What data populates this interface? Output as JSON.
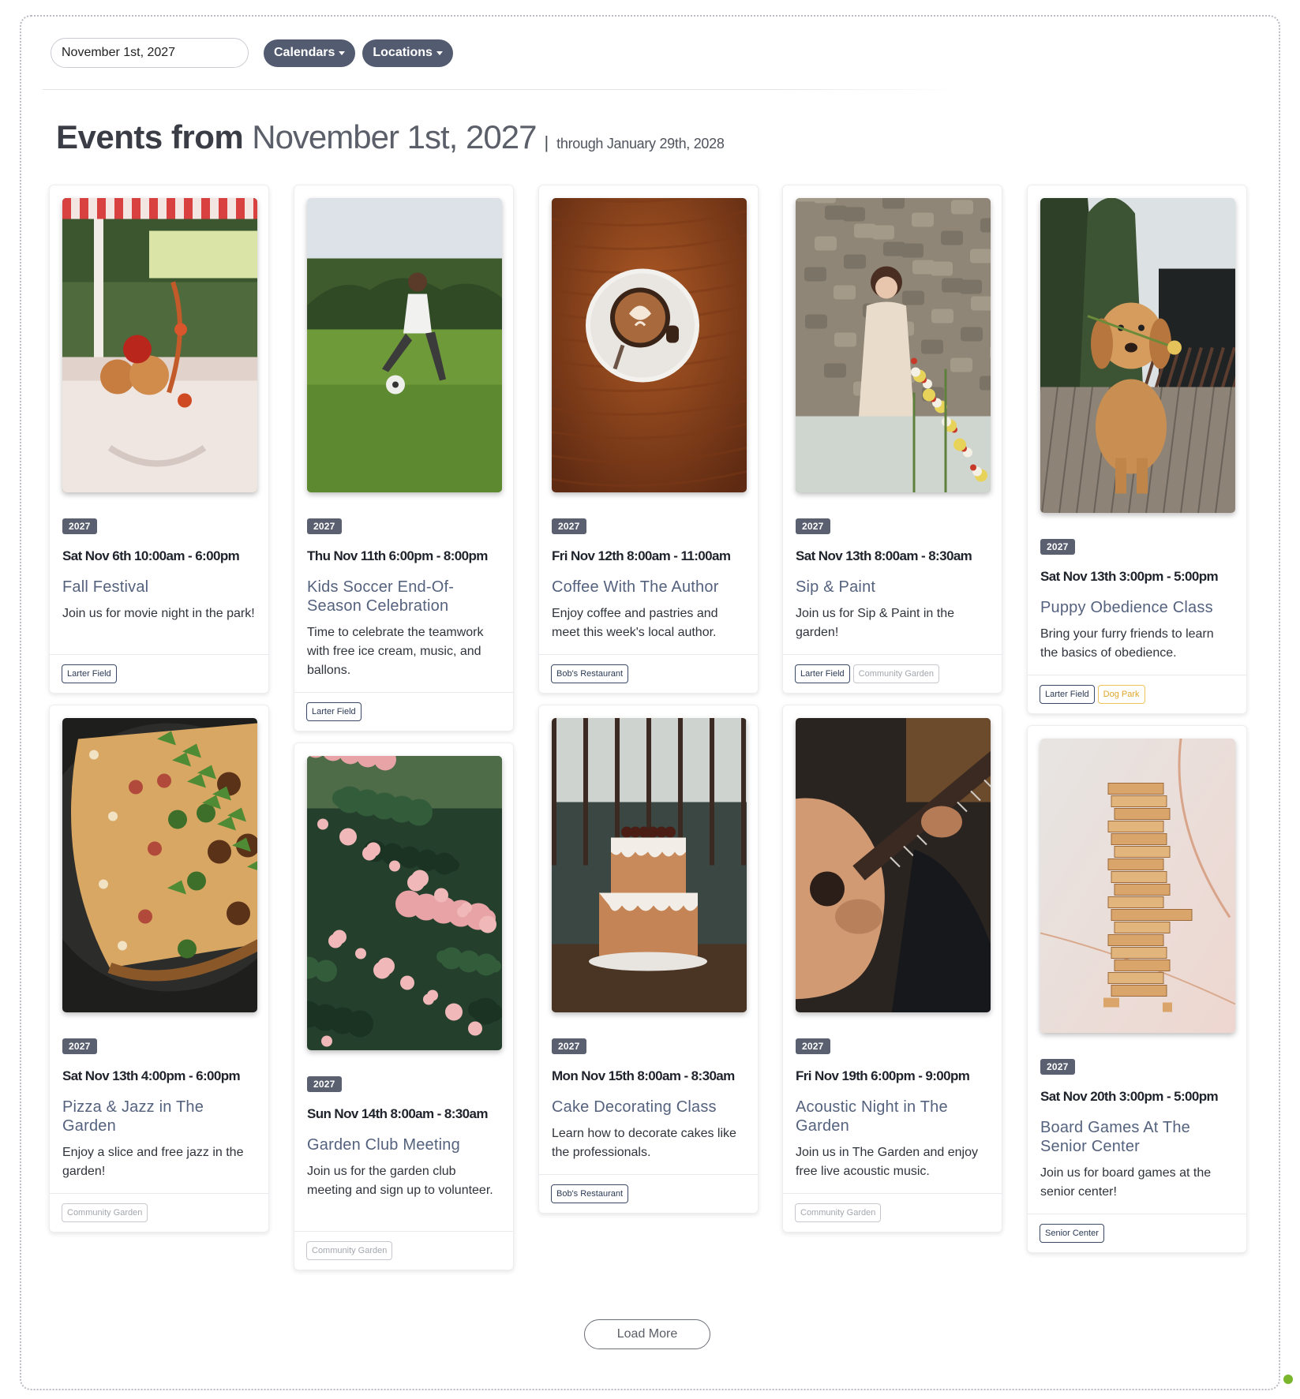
{
  "toolbar": {
    "date_value": "November 1st, 2027",
    "calendars_label": "Calendars",
    "locations_label": "Locations"
  },
  "heading": {
    "prefix": "Events from",
    "start_date": "November 1st, 2027",
    "separator": "|",
    "through": "through January 29th, 2028"
  },
  "events": [
    {
      "year": "2027",
      "when": "Sat Nov 6th 10:00am - 6:00pm",
      "title": "Fall Festival",
      "desc": "Join us for movie night in the park!",
      "tags": [
        {
          "label": "Larter Field",
          "style": "dark"
        }
      ],
      "image": "autumn-cart"
    },
    {
      "year": "2027",
      "when": "Thu Nov 11th 6:00pm - 8:00pm",
      "title": "Kids Soccer End-Of-Season Celebration",
      "desc": "Time to celebrate the teamwork with free ice cream, music, and ballons.",
      "tags": [
        {
          "label": "Larter Field",
          "style": "dark"
        }
      ],
      "image": "soccer-kid"
    },
    {
      "year": "2027",
      "when": "Fri Nov 12th 8:00am - 11:00am",
      "title": "Coffee With The Author",
      "desc": "Enjoy coffee and pastries and meet this week's local author.",
      "tags": [
        {
          "label": "Bob's Restaurant",
          "style": "dark"
        }
      ],
      "image": "latte"
    },
    {
      "year": "2027",
      "when": "Sat Nov 13th 8:00am - 8:30am",
      "title": "Sip & Paint",
      "desc": "Join us for Sip & Paint in the garden!",
      "tags": [
        {
          "label": "Larter Field",
          "style": "dark"
        },
        {
          "label": "Community Garden",
          "style": "muted"
        }
      ],
      "image": "garden-party"
    },
    {
      "year": "2027",
      "when": "Sat Nov 13th 3:00pm - 5:00pm",
      "title": "Puppy Obedience Class",
      "desc": "Bring your furry friends to learn the basics of obedience.",
      "tags": [
        {
          "label": "Larter Field",
          "style": "dark"
        },
        {
          "label": "Dog Park",
          "style": "gold"
        }
      ],
      "image": "puppy"
    },
    {
      "year": "2027",
      "when": "Sat Nov 13th 4:00pm - 6:00pm",
      "title": "Pizza & Jazz in The Garden",
      "desc": "Enjoy a slice and free jazz in the garden!",
      "tags": [
        {
          "label": "Community Garden",
          "style": "muted"
        }
      ],
      "image": "pizza"
    },
    {
      "year": "2027",
      "when": "Sun Nov 14th 8:00am - 8:30am",
      "title": "Garden Club Meeting",
      "desc": "Join us for the garden club meeting and sign up to volunteer.",
      "tags": [
        {
          "label": "Community Garden",
          "style": "muted"
        }
      ],
      "image": "roses"
    },
    {
      "year": "2027",
      "when": "Mon Nov 15th 8:00am - 8:30am",
      "title": "Cake Decorating Class",
      "desc": "Learn how to decorate cakes like the professionals.",
      "tags": [
        {
          "label": "Bob's Restaurant",
          "style": "dark"
        }
      ],
      "image": "cake"
    },
    {
      "year": "2027",
      "when": "Fri Nov 19th 6:00pm - 9:00pm",
      "title": "Acoustic Night in The Garden",
      "desc": "Join us in The Garden and enjoy free live acoustic music.",
      "tags": [
        {
          "label": "Community Garden",
          "style": "muted"
        }
      ],
      "image": "guitar"
    },
    {
      "year": "2027",
      "when": "Sat Nov 20th 3:00pm - 5:00pm",
      "title": "Board Games At The Senior Center",
      "desc": "Join us for board games at the senior center!",
      "tags": [
        {
          "label": "Senior Center",
          "style": "dark"
        }
      ],
      "image": "jenga"
    }
  ],
  "load_more_label": "Load More"
}
